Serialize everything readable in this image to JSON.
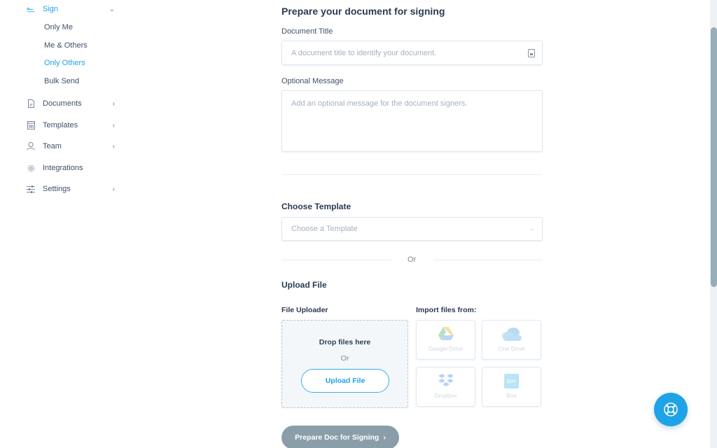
{
  "sidebar": {
    "sign": {
      "label": "Sign",
      "icon": "signature-icon",
      "expanded": true
    },
    "sign_subitems": [
      {
        "label": "Only Me",
        "active": false
      },
      {
        "label": "Me & Others",
        "active": false
      },
      {
        "label": "Only Others",
        "active": true
      },
      {
        "label": "Bulk Send",
        "active": false
      }
    ],
    "items": [
      {
        "label": "Documents",
        "icon": "document-icon",
        "has_chevron": true
      },
      {
        "label": "Templates",
        "icon": "template-icon",
        "has_chevron": true
      },
      {
        "label": "Team",
        "icon": "user-icon",
        "has_chevron": true
      },
      {
        "label": "Integrations",
        "icon": "gear-icon",
        "has_chevron": false
      },
      {
        "label": "Settings",
        "icon": "sliders-icon",
        "has_chevron": true
      }
    ]
  },
  "main": {
    "title": "Prepare your document for signing",
    "document_title": {
      "label": "Document Title",
      "value": "",
      "placeholder": "A document title to identify your document."
    },
    "optional_message": {
      "label": "Optional Message",
      "value": "",
      "placeholder": "Add an optional message for the document signers."
    },
    "choose_template": {
      "heading": "Choose Template",
      "selected": "Choose a Template"
    },
    "or_separator": "Or",
    "upload": {
      "heading": "Upload File",
      "uploader_label": "File Uploader",
      "drop_text": "Drop files here",
      "or_text": "Or",
      "upload_button": "Upload File",
      "import_label": "Import files from:",
      "sources": [
        {
          "label": "Google Drive",
          "icon": "google-drive-icon"
        },
        {
          "label": "One Drive",
          "icon": "onedrive-icon"
        },
        {
          "label": "Dropbox",
          "icon": "dropbox-icon"
        },
        {
          "label": "Box",
          "icon": "box-icon",
          "icon_text": "box"
        }
      ]
    },
    "prepare_button": "Prepare Doc for Signing",
    "prepare_button_chevron": "›"
  },
  "colors": {
    "accent": "#1ea3e6",
    "text_primary": "#2a3b52",
    "text_secondary": "#3e5068",
    "placeholder": "#a6b1bd",
    "button_disabled": "#8a9ea9",
    "dropzone_bg": "#f3f7fa"
  },
  "help": {
    "icon": "lifebuoy-icon"
  }
}
